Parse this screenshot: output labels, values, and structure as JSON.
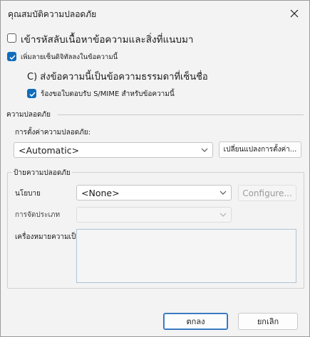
{
  "window": {
    "title": "คุณสมบัติความปลอดภัย"
  },
  "options": {
    "encrypt_label": "เข้ารหัสลับเนื้อหาข้อความและสิ่งที่แนบมา",
    "encrypt_checked": false,
    "sign_label": "เพิ่มลายเซ็นดิจิทัลลงในข้อความนี้",
    "sign_checked": true,
    "clear_text_label": "C) ส่งข้อความนี้เป็นข้อความธรรมดาที่เซ็นชื่อ",
    "smime_label": "ร้องขอใบตอบรับ S/MIME สำหรับข้อความนี้",
    "smime_checked": true
  },
  "security": {
    "section_label": "ความปลอดภัย",
    "settings_label": "การตั้งค่าความปลอดภัย:",
    "settings_value": "<Automatic>",
    "change_button": "เปลี่ยนแปลงการตั้งค่า..."
  },
  "labels": {
    "group_label": "ป้ายความปลอดภัย",
    "policy_label": "นโยบาย",
    "policy_value": "<None>",
    "configure_button": "Configure...",
    "classification_label": "การจัดประเภท",
    "classification_value": "",
    "privacy_label": "เครื่องหมายความเป็นส่วนตัว:"
  },
  "footer": {
    "ok_button": "ตกลง",
    "cancel_button": "ยกเลิก"
  },
  "colors": {
    "accent": "#0f6cbd",
    "window_bg": "#f3f3f3"
  }
}
